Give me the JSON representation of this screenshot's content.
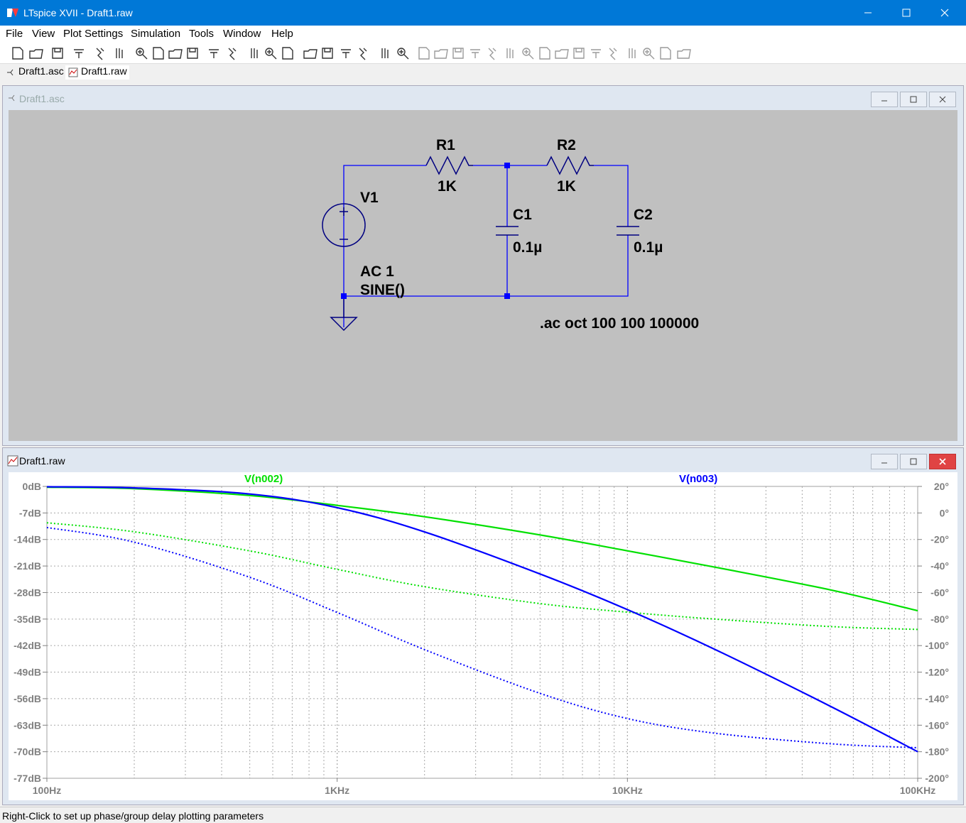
{
  "window": {
    "title": "LTspice XVII - Draft1.raw"
  },
  "menu": [
    "File",
    "View",
    "Plot Settings",
    "Simulation",
    "Tools",
    "Window",
    "Help"
  ],
  "toolbar_icons": [
    "new-schematic-icon",
    "open-icon",
    "save-icon",
    "control-panel-icon",
    "run-icon",
    "halt-icon",
    "zoom-in-icon",
    "zoom-rect-icon",
    "zoom-out-icon",
    "zoom-full-icon",
    "autorange-icon",
    "grid-icon",
    "tile-horizontal-icon",
    "cascade-icon",
    "tile-vertical-icon",
    "cut-icon",
    "copy-icon",
    "paste-icon",
    "find-icon",
    "print-icon",
    "print-setup-icon",
    "wire-icon",
    "ground-icon",
    "label-net-icon",
    "resistor-icon",
    "capacitor-icon",
    "inductor-icon",
    "diode-icon",
    "component-icon",
    "move-icon",
    "drag-icon",
    "undo-icon",
    "redo-icon",
    "rotate-icon",
    "mirror-icon",
    "text-icon",
    "spice-directive-icon"
  ],
  "tabs": [
    {
      "label": "Draft1.asc"
    },
    {
      "label": "Draft1.raw"
    }
  ],
  "schematic": {
    "title": "Draft1.asc",
    "components": {
      "r1_name": "R1",
      "r1_value": "1K",
      "r2_name": "R2",
      "r2_value": "1K",
      "c1_name": "C1",
      "c1_value": "0.1µ",
      "c2_name": "C2",
      "c2_value": "0.1µ",
      "v1_name": "V1",
      "v1_ac": "AC 1",
      "v1_sine": "SINE()"
    },
    "directive": ".ac oct 100 100 100000",
    "colors": {
      "background": "#c0c0c0",
      "wire": "#0000ff",
      "component": "#000080",
      "text": "#000000"
    }
  },
  "plot": {
    "title": "Draft1.raw",
    "trace_labels": {
      "n002": "V(n002)",
      "n003": "V(n003)"
    },
    "left_ticks": [
      "0dB",
      "-7dB",
      "-14dB",
      "-21dB",
      "-28dB",
      "-35dB",
      "-42dB",
      "-49dB",
      "-56dB",
      "-63dB",
      "-70dB",
      "-77dB"
    ],
    "right_ticks": [
      "20°",
      "0°",
      "-20°",
      "-40°",
      "-60°",
      "-80°",
      "-100°",
      "-120°",
      "-140°",
      "-160°",
      "-180°",
      "-200°"
    ],
    "x_ticks": [
      "100Hz",
      "1KHz",
      "10KHz",
      "100KHz"
    ]
  },
  "chart_data": {
    "type": "line",
    "title": "",
    "xlabel": "",
    "ylabel": "",
    "x_scale": "log",
    "xlim": [
      100,
      100000
    ],
    "ylim_left": [
      -77,
      0
    ],
    "ylim_right": [
      -200,
      20
    ],
    "grid": true,
    "x_frequencies_hz": [
      100,
      200,
      500,
      1000,
      2000,
      5000,
      10000,
      20000,
      50000,
      100000
    ],
    "series": [
      {
        "name": "V(n002)",
        "axis": "left",
        "style": "solid",
        "color": "#00e000",
        "values": [
          -0.2,
          -0.6,
          -2.4,
          -5.0,
          -8.0,
          -12.8,
          -17.0,
          -21.3,
          -27.3,
          -32.8
        ]
      },
      {
        "name": "V(n002)",
        "axis": "right",
        "style": "dotted",
        "color": "#00e000",
        "values": [
          -7.4,
          -14.2,
          -28.6,
          -42.5,
          -55.6,
          -68.3,
          -74.8,
          -80.0,
          -85.6,
          -87.8
        ]
      },
      {
        "name": "V(n003)",
        "axis": "left",
        "style": "solid",
        "color": "#0000ff",
        "values": [
          -0.1,
          -0.4,
          -2.0,
          -5.6,
          -12.0,
          -23.1,
          -32.5,
          -43.0,
          -58.0,
          -70.0
        ]
      },
      {
        "name": "V(n003)",
        "axis": "right",
        "style": "dotted",
        "color": "#0000ff",
        "values": [
          -11.0,
          -22.0,
          -48.5,
          -75.0,
          -103.0,
          -136.0,
          -155.0,
          -166.0,
          -174.0,
          -177.0
        ]
      }
    ]
  },
  "status": "Right-Click to set up phase/group delay plotting parameters"
}
